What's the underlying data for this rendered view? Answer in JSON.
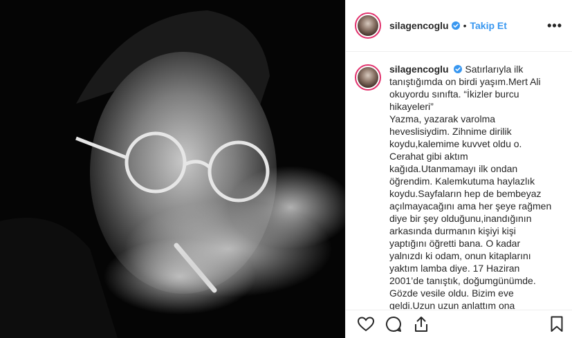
{
  "post": {
    "username": "silagencoglu",
    "follow_label": "Takip Et",
    "separator": "•",
    "more_label": "•••"
  },
  "caption": {
    "username": "silagencoglu",
    "lines": [
      "Satırlarıyla ilk tanıştığımda on birdi yaşım.Mert Ali okuyordu sınıfta. “İkizler burcu hikayeleri”",
      "Yazma, yazarak varolma heveslisiydim. Zihnime dirilik koydu,kalemime kuvvet oldu o. Cerahat gibi aktım kağıda.Utanmamayı ilk ondan öğrendim. Kalemkutuma haylazlık koydu.Sayfaların hep de bembeyaz açılmayacağını ama her şeye rağmen diye bir şey olduğunu,inandığının arkasında durmanın kişiyi kişi yaptığını öğretti bana. O kadar yalnızdı ki odam, onun kitaplarını yaktım lamba diye. 17 Haziran 2001’de tanıştık, doğumgünümde. Gözde vesile oldu. Bizim eve geldi.Uzun uzun anlattım ona hayallerimi, yapacaklarımı. Uzun"
    ]
  },
  "icons": {
    "like": "heart-icon",
    "comment": "comment-icon",
    "share": "share-icon",
    "save": "bookmark-icon",
    "verified": "verified-badge-icon"
  },
  "colors": {
    "follow": "#3897f0",
    "verified": "#3897f0",
    "story_ring": "#e1306c"
  }
}
